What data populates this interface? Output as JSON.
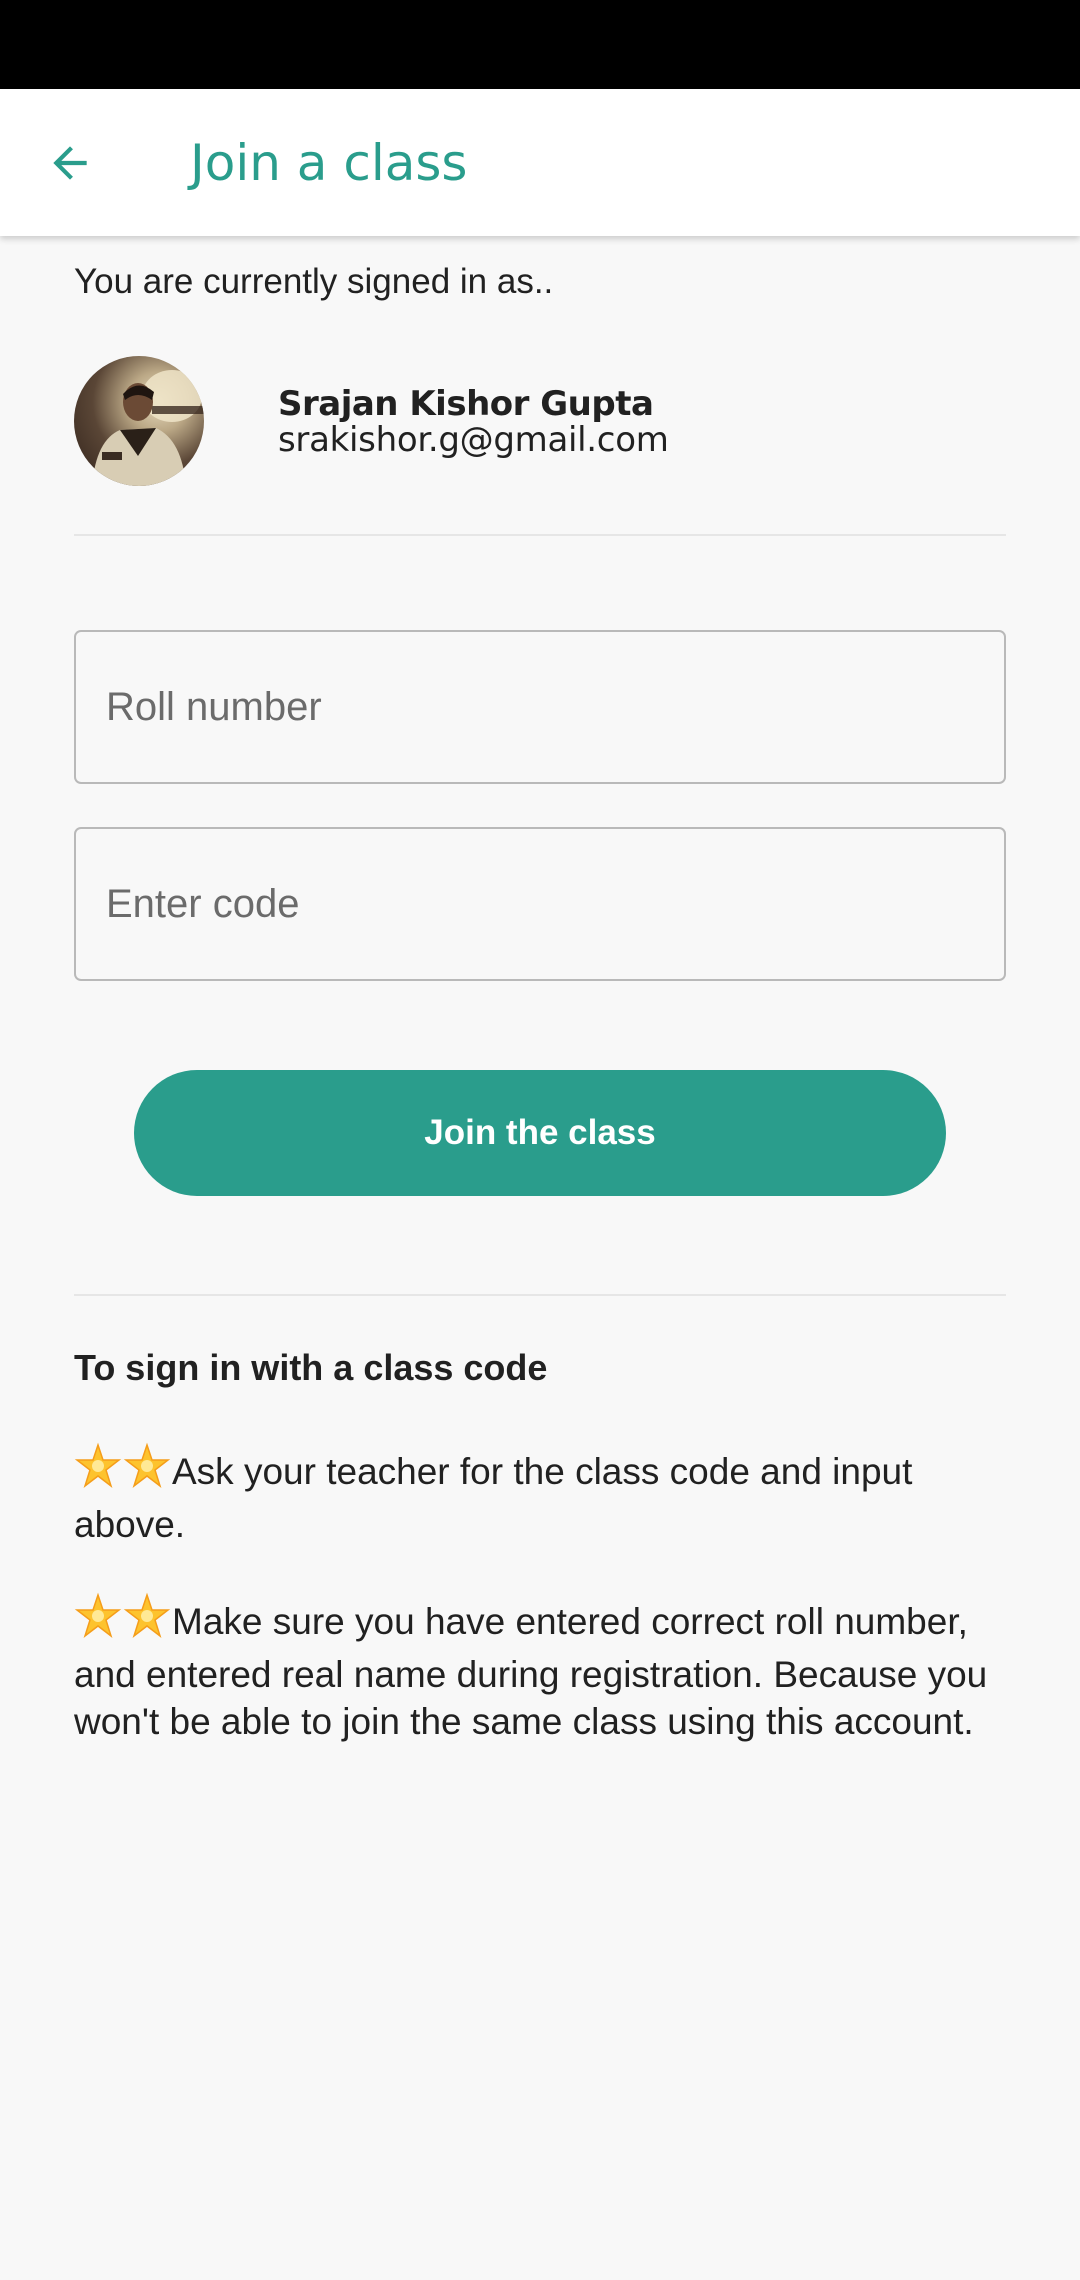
{
  "app_bar": {
    "title": "Join a class",
    "accent_color": "#2a9d8c"
  },
  "account": {
    "signed_in_label": "You are currently signed in as..",
    "name": "Srajan Kishor Gupta",
    "email": "srakishor.g@gmail.com"
  },
  "form": {
    "roll_number_placeholder": "Roll number",
    "code_placeholder": "Enter code",
    "join_button_label": "Join the class"
  },
  "help": {
    "heading": "To sign in with a class code",
    "tip_1": "Ask your teacher for the class code and input above.",
    "tip_2": "Make sure you have entered correct roll number, and entered real name during registration. Because you won't be able to join the same class using this account.",
    "tip_icon": "glowing-star-emoji"
  }
}
